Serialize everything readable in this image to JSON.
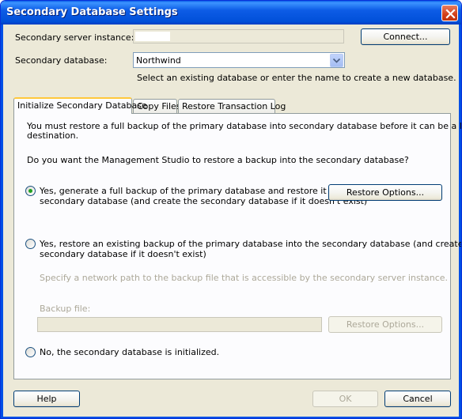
{
  "window": {
    "title": "Secondary Database Settings"
  },
  "server": {
    "label": "Secondary server instance:",
    "connect_button": "Connect..."
  },
  "database": {
    "label": "Secondary database:",
    "value": "Northwind",
    "hint": "Select an existing database or enter the name to create a new database."
  },
  "tabs": [
    {
      "label": "Initialize Secondary Database",
      "active": true
    },
    {
      "label": "Copy Files",
      "active": false
    },
    {
      "label": "Restore Transaction Log",
      "active": false
    }
  ],
  "panel": {
    "intro_line1": "You must restore a full backup of the primary database into secondary database before it can be a log shipping",
    "intro_line2": "destination.",
    "question": "Do you want the Management Studio to restore a backup into the secondary database?",
    "option1": {
      "line1": "Yes, generate a full backup of the primary database and restore it into the",
      "line2": "secondary database (and create the secondary database if it doesn't exist)",
      "selected": true,
      "button": "Restore Options..."
    },
    "option2": {
      "line1": "Yes, restore an existing backup of the primary database into the secondary database (and create the",
      "line2": "secondary database if it doesn't exist)",
      "selected": false,
      "path_hint": "Specify a network path to the backup file that is accessible by the secondary server instance.",
      "backup_label": "Backup file:",
      "button": "Restore Options..."
    },
    "option3": {
      "label": "No, the secondary database is initialized.",
      "selected": false
    }
  },
  "footer": {
    "help": "Help",
    "ok": "OK",
    "cancel": "Cancel"
  },
  "colors": {
    "title_bar": "#0054e3",
    "dialog_bg": "#ece9d8",
    "radio_dot": "#21a121",
    "active_tab_accent": "#ffc83c"
  }
}
